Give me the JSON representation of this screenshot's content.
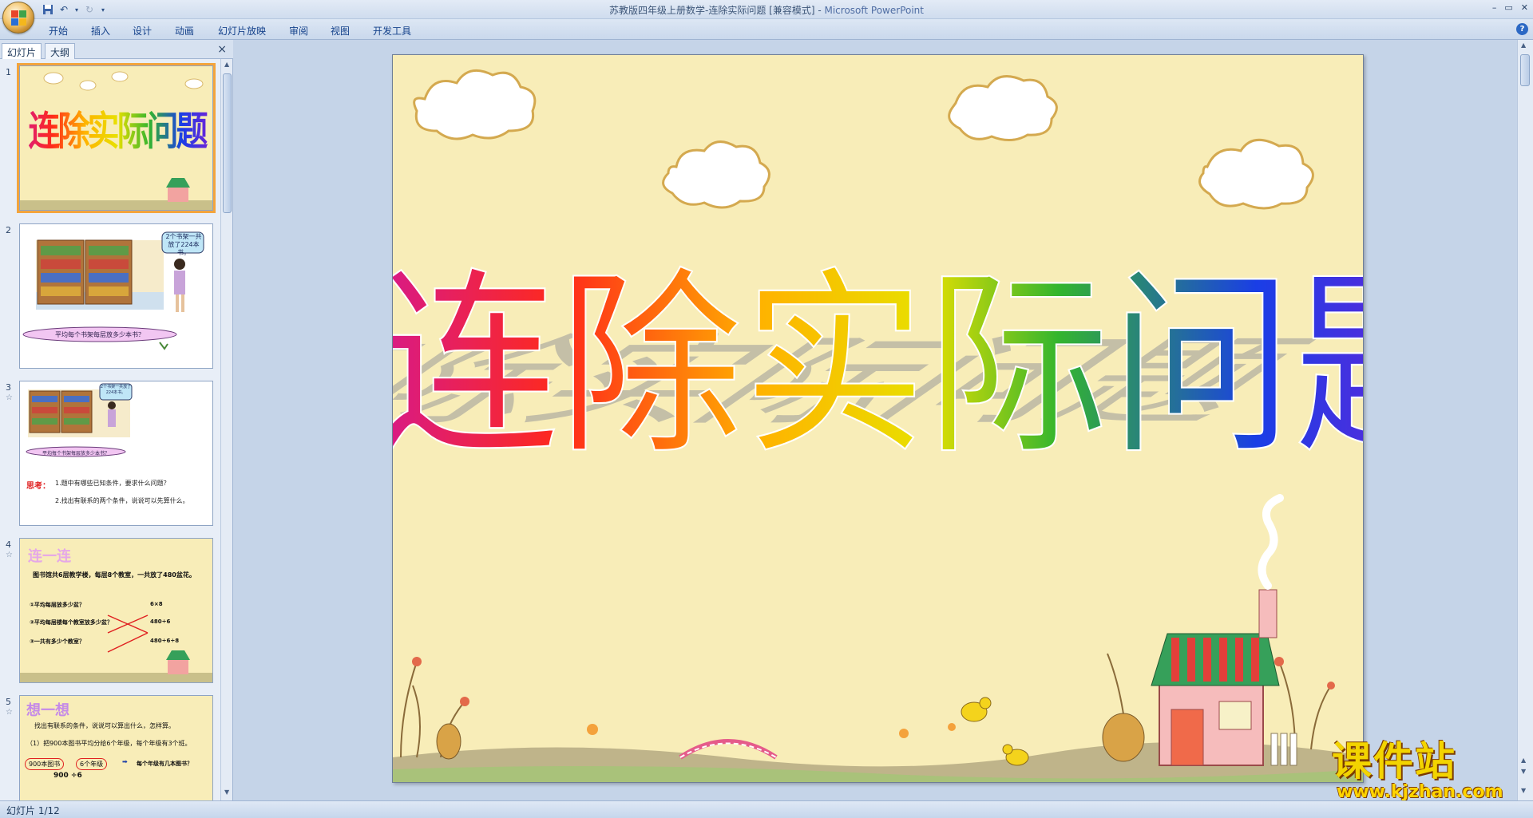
{
  "window": {
    "title": "苏教版四年级上册数学-连除实际问题 [兼容模式]",
    "separator": " - ",
    "app_name": "Microsoft PowerPoint",
    "minimize": "–",
    "restore": "▭",
    "close": "✕"
  },
  "ribbon": {
    "tabs": [
      "开始",
      "插入",
      "设计",
      "动画",
      "幻灯片放映",
      "审阅",
      "视图",
      "开发工具"
    ],
    "help": "?"
  },
  "slide_pane": {
    "tab_slides": "幻灯片",
    "tab_outline": "大纲",
    "close": "×",
    "thumbnails": [
      {
        "num": "1",
        "star": "",
        "title": "连除实际问题"
      },
      {
        "num": "2",
        "star": "",
        "bubble": "2个书架一共放了224本书。",
        "question": "平均每个书架每层放多少本书？"
      },
      {
        "num": "3",
        "star": "☆",
        "bubble": "2个书架一共放了224本书。",
        "question": "平均每个书架每层放多少本书？",
        "think_label": "思考：",
        "think1": "1.题中有哪些已知条件，要求什么问题？",
        "think2": "2.找出有联系的两个条件，说说可以先算什么。"
      },
      {
        "num": "4",
        "star": "☆",
        "heading": "连一连",
        "text": "图书馆共6层教学楼，每层8个教室，一共放了480盆花。",
        "left": [
          "①平均每层放多少盆？",
          "②平均每层楼每个教室放多少盆？",
          "③一共有多少个教室？"
        ],
        "right": [
          "6×8",
          "480÷6",
          "480÷6÷8"
        ]
      },
      {
        "num": "5",
        "star": "☆",
        "heading": "想一想",
        "line1": "找出有联系的条件，说说可以算出什么，怎样算。",
        "line2": "（1）把900本图书平均分给6个年级，每个年级有3个班。",
        "box1": "900本图书",
        "box2": "6个年级",
        "result": "每个年级有几本图书？",
        "formula": "900 ÷6"
      }
    ]
  },
  "slide": {
    "title": "连除实际问题"
  },
  "status": {
    "text": "幻灯片 1/12"
  },
  "watermark": {
    "text": "课件站",
    "url": "www.kjzhan.com"
  },
  "colors": {
    "slide_bg": "#f8edb8",
    "title_gradient": [
      "#d6198c",
      "#ff2a1a",
      "#ffb300",
      "#f2e600",
      "#33b52e",
      "#1a3ee6",
      "#7b1fd6"
    ]
  }
}
